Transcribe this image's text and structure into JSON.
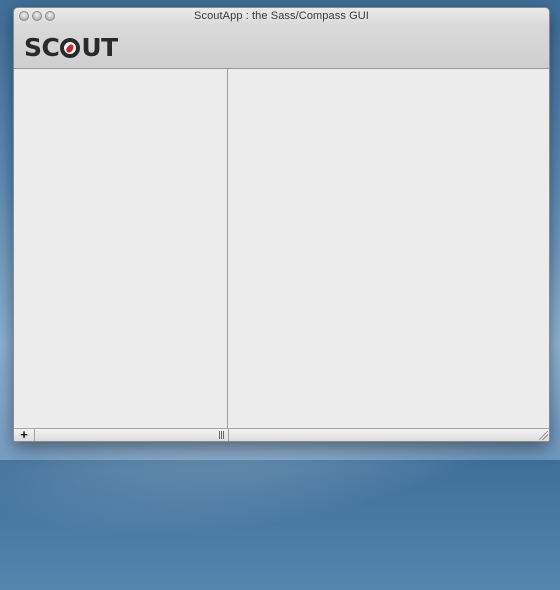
{
  "window": {
    "title": "ScoutApp : the Sass/Compass GUI"
  },
  "logo": {
    "text_before": "SC",
    "text_after": "UT",
    "mark_icon": "scout-compass-icon",
    "accent_color": "#c8282b"
  },
  "toolbar": {
    "add_icon": "plus-icon",
    "add_label": "+"
  },
  "colors": {
    "pane_background": "#ececec",
    "divider": "#9e9e9e"
  }
}
